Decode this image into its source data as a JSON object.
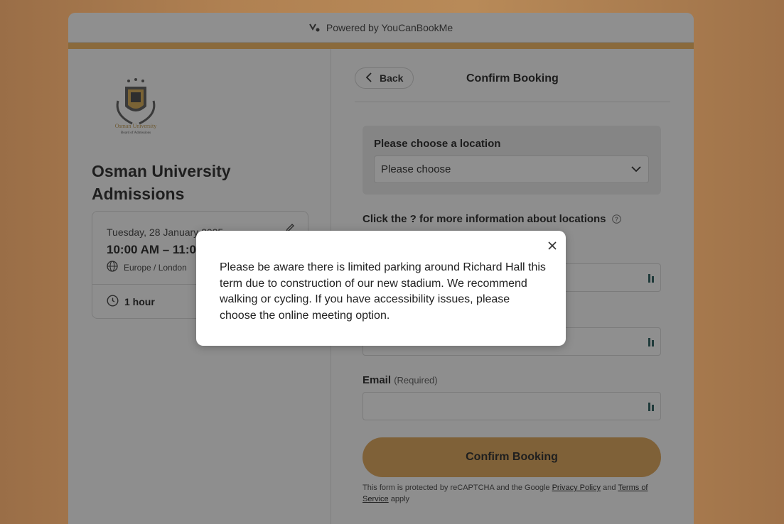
{
  "topbar": {
    "powered_by": "Powered by YouCanBookMe",
    "icon": "youcanbookme-logo-icon"
  },
  "colors": {
    "accent": "#8a6a3c",
    "confirm_button": "#7f6138",
    "overlay_bg": "#8e8e8e"
  },
  "sidebar": {
    "org_name": "Osman University Admissions",
    "logo_caption": "Osman University",
    "logo_subcaption": "Board of Admissions",
    "event": {
      "date": "Tuesday, 28 January 2025",
      "time": "10:00 AM – 11:00 AM",
      "timezone": "Europe / London",
      "duration": "1 hour"
    }
  },
  "main": {
    "back_label": "Back",
    "title": "Confirm Booking",
    "location": {
      "label": "Please choose a location",
      "selected": "Please choose"
    },
    "info_text": "Click the ? for more information about locations",
    "email_label": "Email",
    "email_required": "(Required)",
    "confirm_label": "Confirm Booking",
    "legal": {
      "prefix": "This form is protected by reCAPTCHA and the Google ",
      "privacy": "Privacy Policy",
      "and": " and ",
      "terms": "Terms of Service",
      "suffix": " apply"
    }
  },
  "modal": {
    "text": "Please be aware there is limited parking around Richard Hall this term due to construction of our new stadium. We recommend walking or cycling. If you have accessibility issues, please choose the online meeting option."
  }
}
